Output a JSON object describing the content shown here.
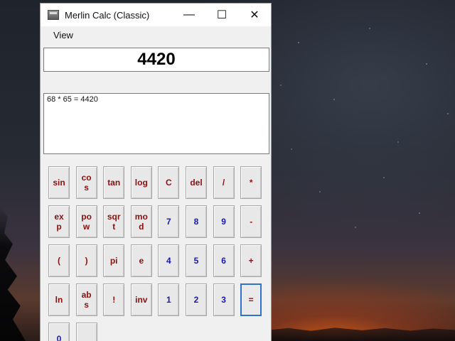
{
  "window": {
    "title": "Merlin Calc (Classic)"
  },
  "titlebar": {
    "minimize_glyph": "—",
    "maximize_glyph": "☐",
    "close_glyph": "✕"
  },
  "menu": {
    "items": [
      "View"
    ]
  },
  "display": {
    "value": "4420"
  },
  "history": {
    "lines": [
      "68 * 65 = 4420"
    ]
  },
  "keypad": {
    "rows": [
      [
        {
          "label": "sin",
          "kind": "fn"
        },
        {
          "label": "cos",
          "kind": "fn"
        },
        {
          "label": "tan",
          "kind": "fn"
        },
        {
          "label": "log",
          "kind": "fn"
        },
        {
          "label": "C",
          "kind": "fn"
        },
        {
          "label": "del",
          "kind": "fn"
        },
        {
          "label": "/",
          "kind": "fn"
        },
        {
          "label": "*",
          "kind": "fn"
        }
      ],
      [
        {
          "label": "exp",
          "kind": "fn"
        },
        {
          "label": "pow",
          "kind": "fn"
        },
        {
          "label": "sqrt",
          "kind": "fn"
        },
        {
          "label": "mod",
          "kind": "fn"
        },
        {
          "label": "7",
          "kind": "num"
        },
        {
          "label": "8",
          "kind": "num"
        },
        {
          "label": "9",
          "kind": "num"
        },
        {
          "label": "-",
          "kind": "fn"
        }
      ],
      [
        {
          "label": "(",
          "kind": "fn"
        },
        {
          "label": ")",
          "kind": "fn"
        },
        {
          "label": "pi",
          "kind": "fn"
        },
        {
          "label": "e",
          "kind": "fn"
        },
        {
          "label": "4",
          "kind": "num"
        },
        {
          "label": "5",
          "kind": "num"
        },
        {
          "label": "6",
          "kind": "num"
        },
        {
          "label": "+",
          "kind": "fn"
        }
      ],
      [
        {
          "label": "ln",
          "kind": "fn"
        },
        {
          "label": "abs",
          "kind": "fn"
        },
        {
          "label": "!",
          "kind": "fn"
        },
        {
          "label": "inv",
          "kind": "fn"
        },
        {
          "label": "1",
          "kind": "num"
        },
        {
          "label": "2",
          "kind": "num"
        },
        {
          "label": "3",
          "kind": "num"
        },
        {
          "label": "=",
          "kind": "fn",
          "focused": true
        }
      ],
      [
        {
          "label": "0",
          "kind": "num"
        },
        {
          "label": "",
          "kind": "fn"
        }
      ]
    ]
  }
}
